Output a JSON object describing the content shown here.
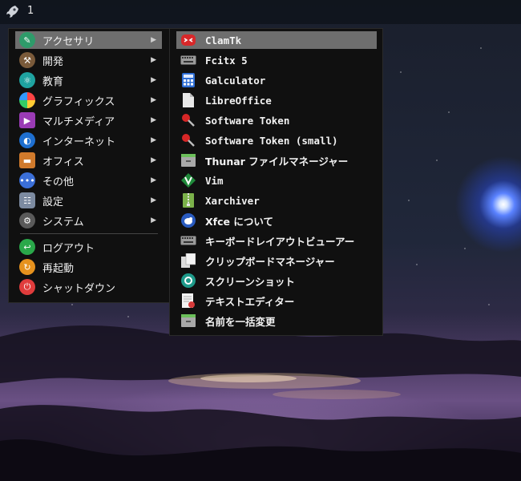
{
  "panel": {
    "workspace": "1",
    "launcher_icon": "rocket-icon"
  },
  "main_menu": {
    "items": [
      {
        "label": "アクセサリ",
        "icon": "accessories-icon",
        "color": "#2e9b6a",
        "has_submenu": true,
        "selected": true
      },
      {
        "label": "開発",
        "icon": "hammer-icon",
        "color": "#7a5a3a",
        "has_submenu": true
      },
      {
        "label": "教育",
        "icon": "education-icon",
        "color": "#1fa3a0",
        "has_submenu": true
      },
      {
        "label": "グラフィックス",
        "icon": "graphics-icon",
        "color": "#e04f8c",
        "has_submenu": true
      },
      {
        "label": "マルチメディア",
        "icon": "multimedia-icon",
        "color": "#9a3bb5",
        "has_submenu": true
      },
      {
        "label": "インターネット",
        "icon": "globe-icon",
        "color": "#1e6fd0",
        "has_submenu": true
      },
      {
        "label": "オフィス",
        "icon": "briefcase-icon",
        "color": "#d07a2c",
        "has_submenu": true
      },
      {
        "label": "その他",
        "icon": "more-icon",
        "color": "#3b6fd8",
        "has_submenu": true
      },
      {
        "label": "設定",
        "icon": "settings-icon",
        "color": "#7c8aa0",
        "has_submenu": true
      },
      {
        "label": "システム",
        "icon": "system-gear-icon",
        "color": "#5a5a5a",
        "has_submenu": true
      },
      {
        "label": "ログアウト",
        "icon": "logout-icon",
        "color": "#2aa84a",
        "has_submenu": false
      },
      {
        "label": "再起動",
        "icon": "restart-icon",
        "color": "#e6921e",
        "has_submenu": false
      },
      {
        "label": "シャットダウン",
        "icon": "power-icon",
        "color": "#e03c3c",
        "has_submenu": false
      }
    ],
    "arrow": "▶"
  },
  "submenu": {
    "items": [
      {
        "label": "ClamTk",
        "icon": "clamtk-icon",
        "selected": true
      },
      {
        "label": "Fcitx 5",
        "icon": "keyboard-icon"
      },
      {
        "label": "Galculator",
        "icon": "calculator-icon"
      },
      {
        "label": "LibreOffice",
        "icon": "document-icon"
      },
      {
        "label": "Software Token",
        "icon": "token-key-icon"
      },
      {
        "label": "Software Token (small)",
        "icon": "token-key-icon"
      },
      {
        "label": "Thunar ファイルマネージャー",
        "icon": "file-manager-icon"
      },
      {
        "label": "Vim",
        "icon": "vim-icon"
      },
      {
        "label": "Xarchiver",
        "icon": "archive-icon"
      },
      {
        "label": "Xfce について",
        "icon": "xfce-mouse-icon"
      },
      {
        "label": "キーボードレイアウトビューアー",
        "icon": "keyboard-icon"
      },
      {
        "label": "クリップボードマネージャー",
        "icon": "clipboard-icon"
      },
      {
        "label": "スクリーンショット",
        "icon": "camera-shutter-icon"
      },
      {
        "label": "テキストエディター",
        "icon": "text-editor-icon"
      },
      {
        "label": "名前を一括変更",
        "icon": "bulk-rename-icon"
      }
    ]
  }
}
